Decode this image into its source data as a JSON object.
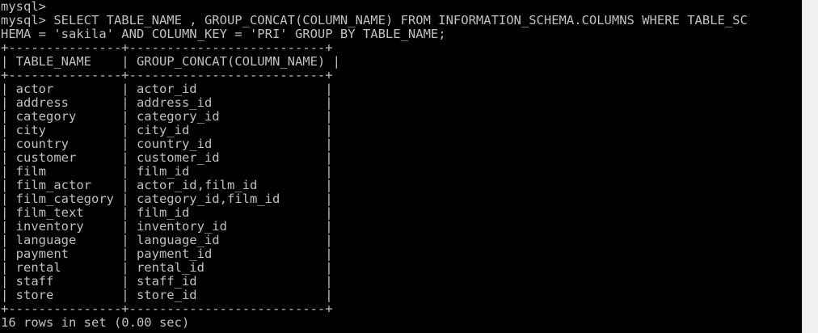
{
  "terminal": {
    "lines": [
      "mysql>",
      "mysql> SELECT TABLE_NAME , GROUP_CONCAT(COLUMN_NAME) FROM INFORMATION_SCHEMA.COLUMNS WHERE TABLE_SC",
      "HEMA = 'sakila' AND COLUMN_KEY = 'PRI' GROUP BY TABLE_NAME;",
      "+---------------+--------------------------+",
      "| TABLE_NAME    | GROUP_CONCAT(COLUMN_NAME) |",
      "+---------------+--------------------------+",
      "| actor         | actor_id                 |",
      "| address       | address_id               |",
      "| category      | category_id              |",
      "| city          | city_id                  |",
      "| country       | country_id               |",
      "| customer      | customer_id              |",
      "| film          | film_id                  |",
      "| film_actor    | actor_id,film_id         |",
      "| film_category | category_id,film_id      |",
      "| film_text     | film_id                  |",
      "| inventory     | inventory_id             |",
      "| language      | language_id              |",
      "| payment       | payment_id               |",
      "| rental        | rental_id                |",
      "| staff         | staff_id                 |",
      "| store         | store_id                 |",
      "+---------------+--------------------------+",
      "16 rows in set (0.00 sec)"
    ]
  }
}
